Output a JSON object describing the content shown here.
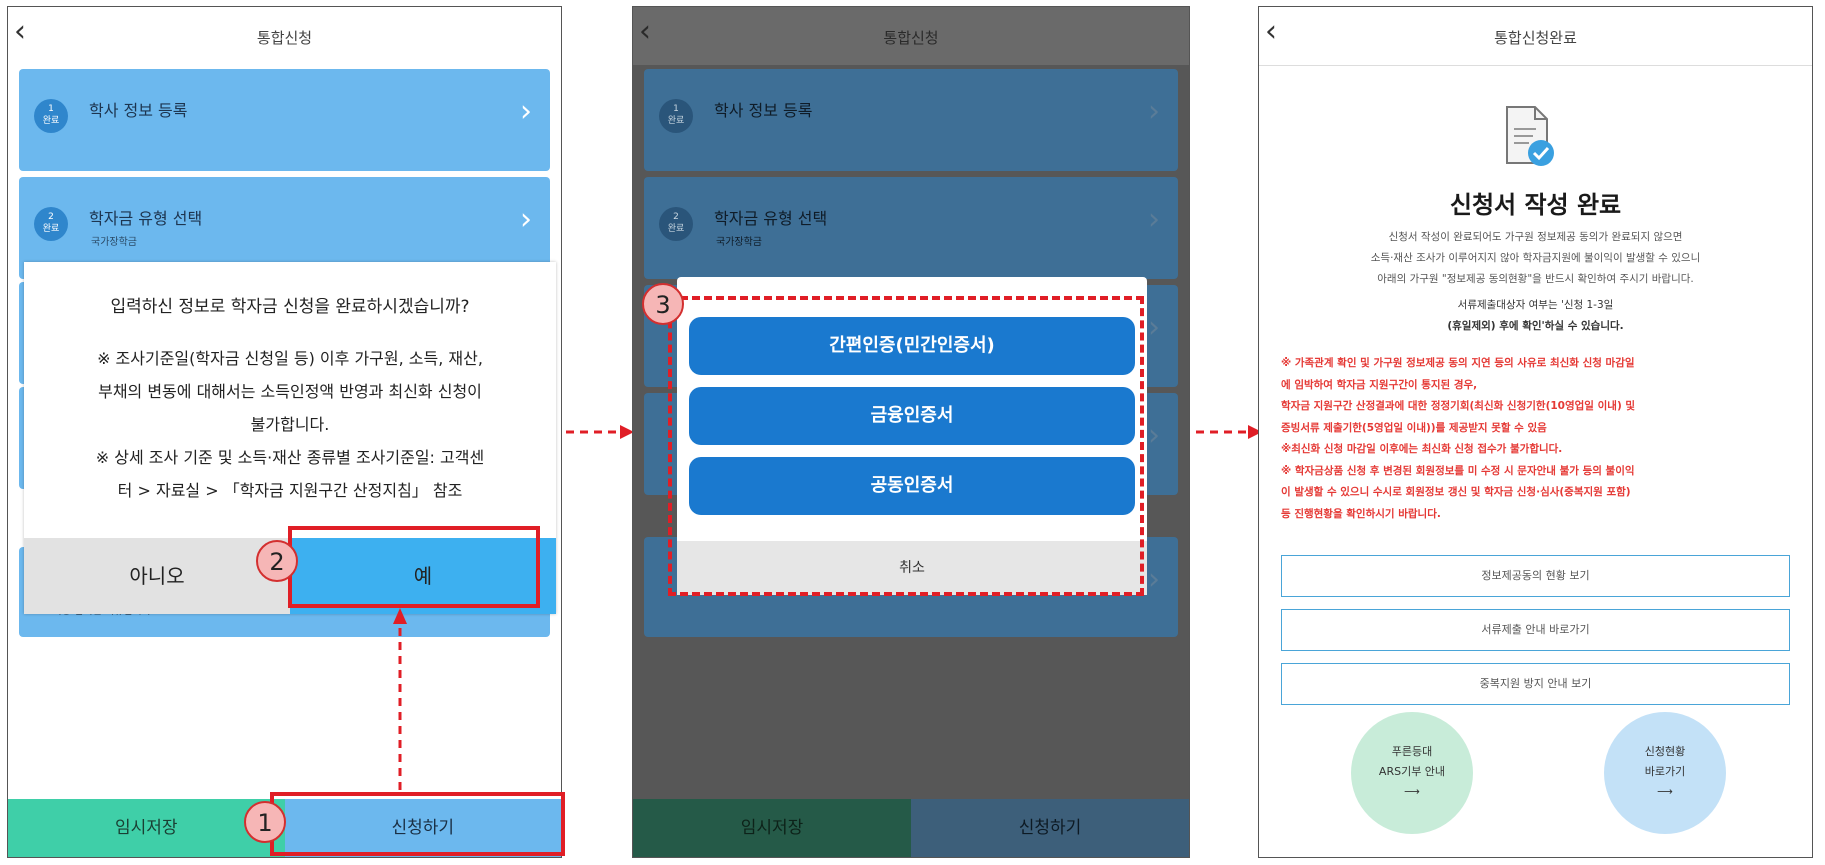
{
  "panel1": {
    "title": "통합신청",
    "steps": [
      {
        "badge": "1\n완료",
        "label": "학사 정보 등록",
        "sub": ""
      },
      {
        "badge": "2\n완료",
        "label": "학자금 유형 선택",
        "sub": "국가장학금"
      }
    ],
    "step_hidden_sub": "※ 희망 입력된 서류입니다.",
    "dialog": {
      "question": "입력하신 정보로 학자금 신청을 완료하시겠습니까?",
      "notes": [
        "※ 조사기준일(학자금 신청일 등) 이후 가구원, 소득, 재산,",
        "부채의 변동에 대해서는 소득인정액 반영과 최신화 신청이",
        "불가합니다.",
        "※ 상세 조사 기준 및 소득·재산 종류별 조사기준일: 고객센",
        "터 > 자료실 > 「학자금 지원구간 산정지침」 참조"
      ],
      "no_label": "아니오",
      "yes_label": "예"
    },
    "bottom": {
      "left": "임시저장",
      "right": "신청하기"
    },
    "markers": {
      "m1": "1",
      "m2": "2"
    }
  },
  "panel2": {
    "title": "통합신청",
    "steps": [
      {
        "badge": "1\n완료",
        "label": "학사 정보 등록",
        "sub": ""
      },
      {
        "badge": "2\n완료",
        "label": "학자금 유형 선택",
        "sub": "국가장학금"
      }
    ],
    "cert_options": [
      "간편인증(민간인증서)",
      "금융인증서",
      "공동인증서"
    ],
    "cancel_label": "취소",
    "bottom": {
      "left": "임시저장",
      "right": "신청하기"
    },
    "marker": "3"
  },
  "panel3": {
    "title": "통합신청완료",
    "heading": "신청서 작성 완료",
    "info": [
      "신청서 작성이 완료되어도 가구원 정보제공 동의가 완료되지 않으면",
      "소득·재산 조사가 이루어지지 않아 학자금지원에 불이익이 발생할 수 있으니",
      "아래의 가구원 \"정보제공 동의현황\"을 반드시 확인하여 주시기 바랍니다."
    ],
    "info2": [
      "서류제출대상자 여부는 '신청 1-3일",
      "(휴일제외) 후에 확인'하실 수 있습니다."
    ],
    "warnings": [
      "※ 가족관계 확인 및 가구원 정보제공 동의 지연 등의 사유로 최신화 신청 마감일",
      "에 임박하여 학자금 지원구간이 통지된 경우,",
      "학자금 지원구간 산정결과에 대한 정정기회(최신화 신청기한(10영업일 이내) 및",
      "증빙서류 제출기한(5영업일 이내))를 제공받지 못할 수 있음",
      "※최신화 신청 마감일 이후에는 최신화 신청 접수가 불가합니다.",
      "※ 학자금상품 신청 후 변경된 회원정보를 미 수정 시 문자안내 불가 등의 불이익",
      "이 발생할 수 있으니 수시로 회원정보 갱신 및 학자금 신청·심사(중복지원 포함)",
      "등 진행현황을 확인하시기 바랍니다."
    ],
    "buttons": [
      "정보제공동의 현황 보기",
      "서류제출 안내 바로가기",
      "중복지원 방지 안내 보기"
    ],
    "circles": [
      {
        "line1": "푸른등대",
        "line2": "ARS기부 안내",
        "arrow": "⟶"
      },
      {
        "line1": "신청현황",
        "line2": "바로가기",
        "arrow": "⟶"
      }
    ]
  }
}
